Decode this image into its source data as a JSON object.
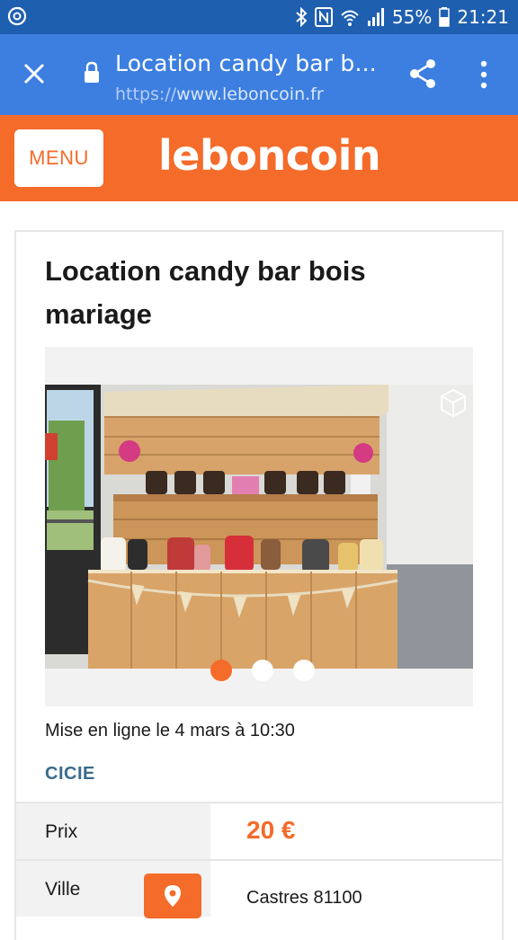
{
  "status_bar": {
    "battery": "55%",
    "time": "21:21",
    "icons": [
      "sync-icon",
      "bluetooth-icon",
      "nfc-icon",
      "wifi-icon",
      "signal-icon",
      "battery-icon"
    ]
  },
  "browser": {
    "tab_title": "Location candy bar b...",
    "url_scheme": "https://",
    "url_host": "www.leboncoin.fr",
    "icons": [
      "close-icon",
      "lock-icon",
      "share-icon",
      "more-vert-icon"
    ]
  },
  "header": {
    "menu_label": "MENU",
    "logo_text": "leboncoin",
    "accent": "#f56b2a"
  },
  "ad": {
    "title": "Location candy bar bois mariage",
    "posted": "Mise en ligne le 4 mars à 10:30",
    "seller": "CICIE",
    "gallery": {
      "image_count": 3,
      "current_index": 1
    },
    "rows": [
      {
        "label": "Prix",
        "value": "20 €"
      },
      {
        "label": "Ville",
        "value": "Castres 81100"
      }
    ]
  }
}
